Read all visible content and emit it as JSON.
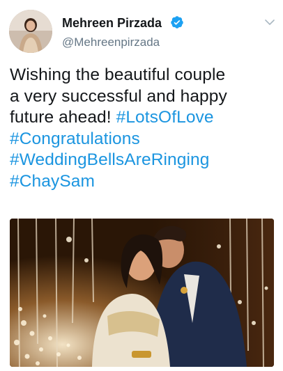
{
  "tweet": {
    "author": {
      "display_name": "Mehreen Pirzada",
      "handle": "@Mehreenpirzada",
      "verified": true,
      "avatar_icon": "profile-photo"
    },
    "menu_icon": "chevron-down-icon",
    "text": {
      "line1": "Wishing the beautiful couple",
      "line2": "a very successful and happy",
      "line3_plain": "future ahead! ",
      "hashtags": [
        "#LotsOfLove",
        "#Congratulations",
        "#WeddingBellsAreRinging",
        "#ChaySam"
      ]
    },
    "media": {
      "type": "photo",
      "description_icon": "couple-photo"
    }
  },
  "colors": {
    "text": "#14171a",
    "secondary": "#657786",
    "link": "#1b95e0",
    "verified_badge": "#1da1f2"
  }
}
